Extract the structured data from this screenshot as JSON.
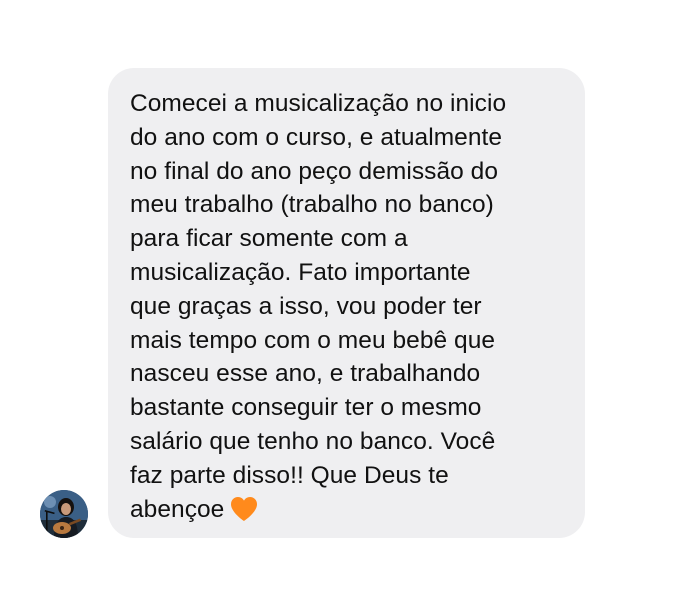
{
  "message": {
    "lines": [
      "Comecei a musicalização no inicio",
      "do ano com o curso, e atualmente",
      "no final do ano peço demissão do",
      "meu trabalho (trabalho no banco)",
      "para ficar somente com a",
      "musicalização. Fato importante",
      "que graças a isso, vou poder ter",
      "mais tempo com o meu bebê que",
      "nasceu esse ano, e trabalhando",
      "bastante conseguir ter o mesmo",
      "salário que tenho no banco. Você",
      "faz parte disso!! Que Deus te",
      "abençoe"
    ],
    "trailing_emoji": "orange-heart-icon",
    "bubble_color": "#efeff1",
    "text_color": "#111111",
    "heart_color": "#ff8a1c"
  },
  "sender": {
    "avatar": "profile-photo-avatar"
  }
}
